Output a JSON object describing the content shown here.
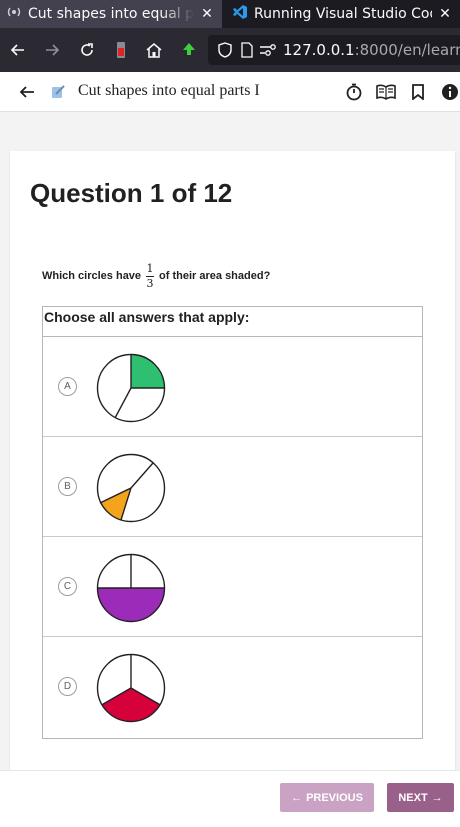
{
  "browser": {
    "tabs": [
      {
        "title": "Cut shapes into equal parts I",
        "active": true
      },
      {
        "title": "Running Visual Studio Code",
        "active": false
      }
    ],
    "url": {
      "host": "127.0.0.1",
      "path": ":8000/en/learn/#"
    }
  },
  "app_bar": {
    "title": "Cut shapes into equal parts I",
    "icons": [
      "back-arrow-icon",
      "exercise-icon",
      "timer-icon",
      "book-icon",
      "bookmark-icon",
      "info-icon"
    ]
  },
  "question": {
    "heading": "Question 1 of 12",
    "prompt_before": "Which circles have",
    "fraction_num": "1",
    "fraction_den": "3",
    "prompt_after": "of their area shaded?",
    "instruction": "Choose all answers that apply:"
  },
  "options": [
    {
      "letter": "A",
      "parts": 3,
      "shaded_fraction": 0.3333,
      "color": "#2fbf71"
    },
    {
      "letter": "B",
      "parts": 3,
      "shaded_fraction": 0.25,
      "color": "#f4a41c"
    },
    {
      "letter": "C",
      "parts": 3,
      "shaded_fraction": 0.5,
      "color": "#9b2bb8"
    },
    {
      "letter": "D",
      "parts": 3,
      "shaded_fraction": 0.3333,
      "color": "#d6003b"
    }
  ],
  "navigation": {
    "previous_label": "PREVIOUS",
    "next_label": "NEXT"
  },
  "colors": {
    "brand_next": "#996189",
    "brand_previous_disabled": "#c9a2c4"
  }
}
